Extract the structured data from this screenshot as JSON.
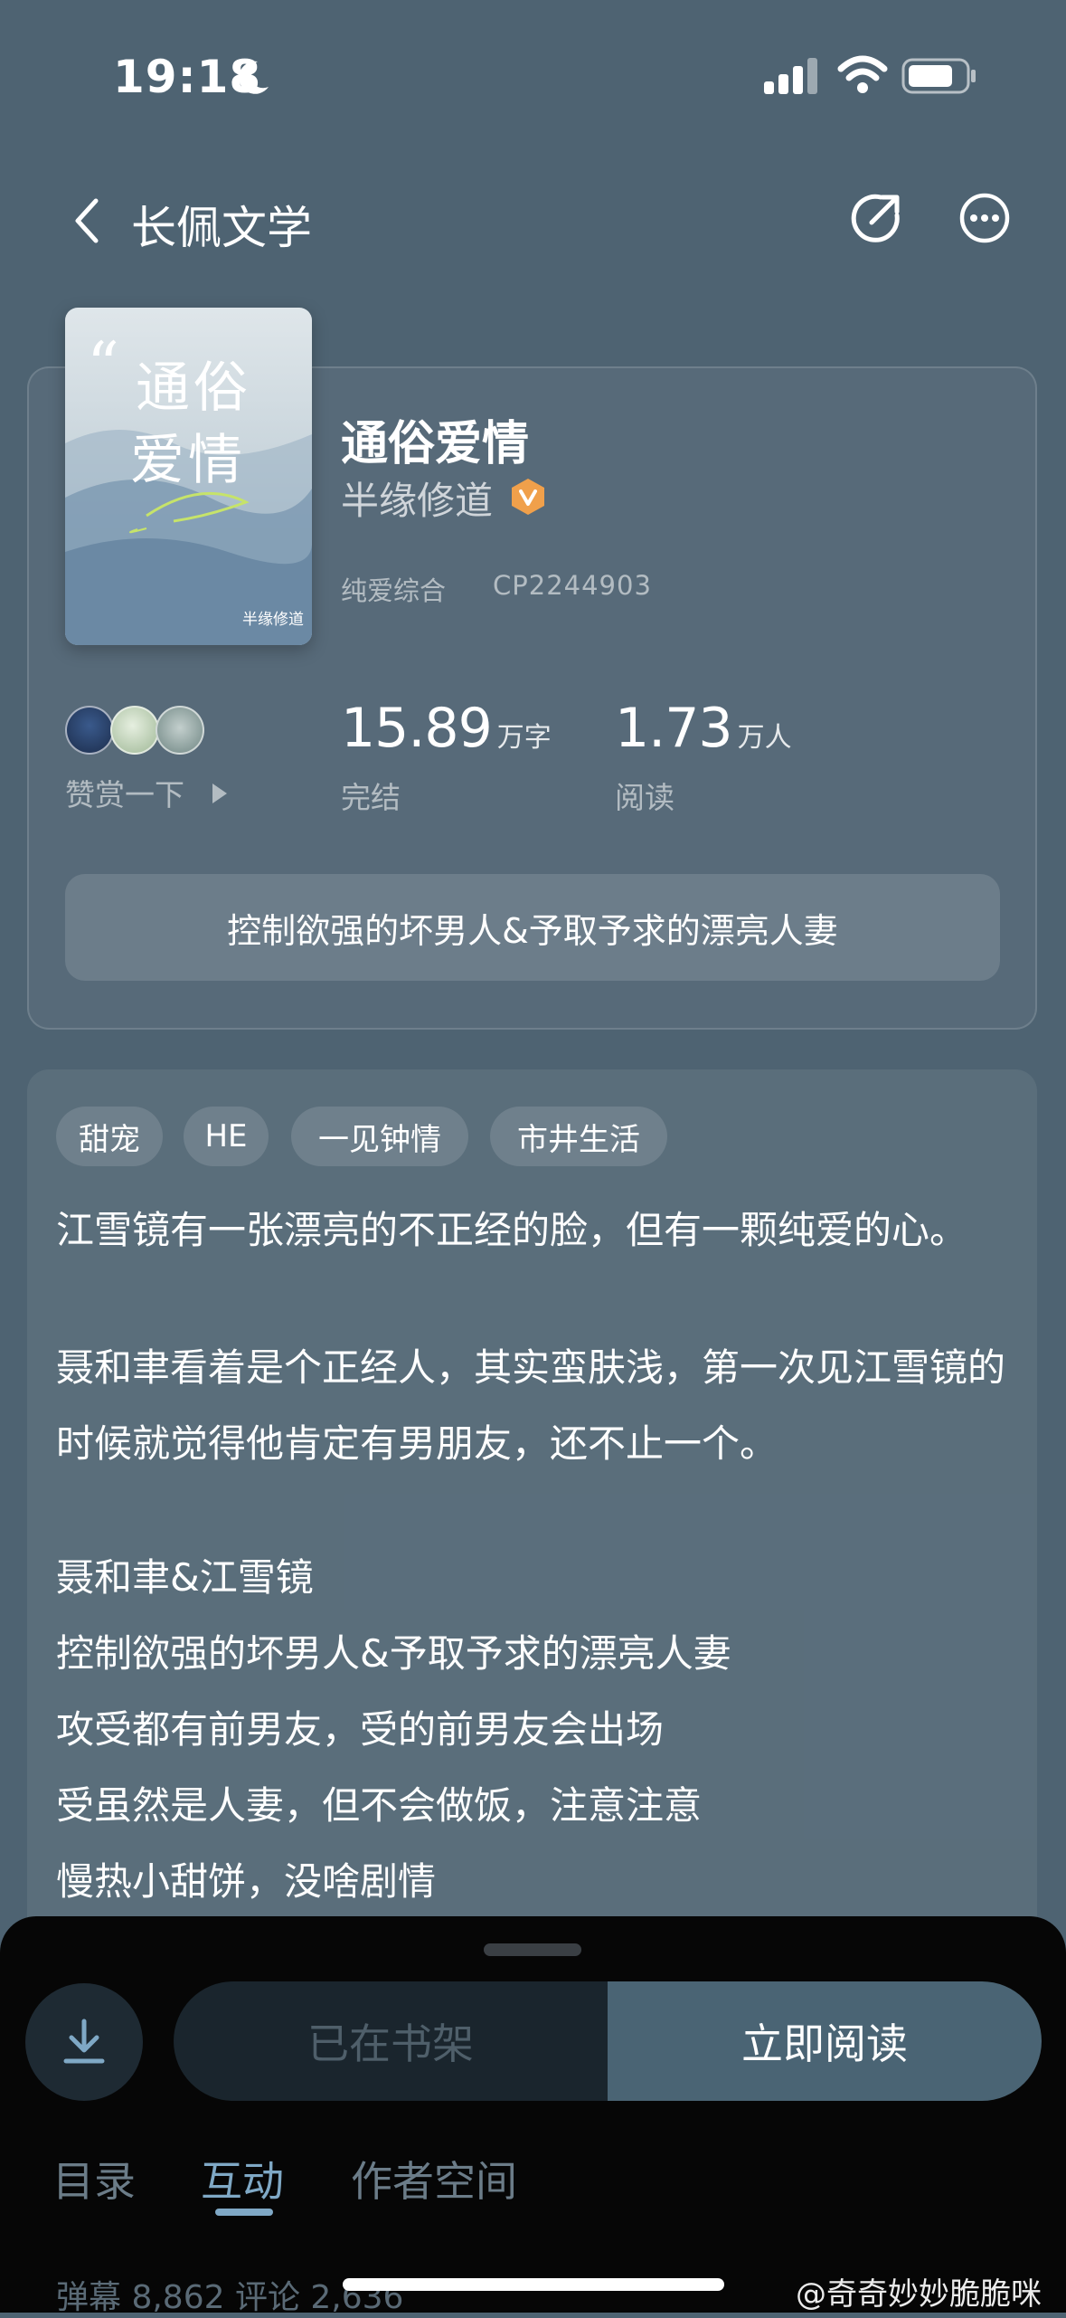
{
  "status_bar": {
    "time": "19:18"
  },
  "nav": {
    "title": "长佩文学"
  },
  "book": {
    "title": "通俗爱情",
    "author": "半缘修道",
    "category": "纯爱综合",
    "cp_id": "CP2244903",
    "cover": {
      "title_line1": "通俗",
      "title_line2": "爱情",
      "author": "半缘修道"
    },
    "reward_label": "赞赏一下",
    "words": {
      "value": "15.89",
      "unit": "万字",
      "label": "完结"
    },
    "reads": {
      "value": "1.73",
      "unit": "万人",
      "label": "阅读"
    },
    "tagline": "控制欲强的坏男人&予取予求的漂亮人妻"
  },
  "tags": [
    "甜宠",
    "HE",
    "一见钟情",
    "市井生活"
  ],
  "description": [
    "江雪镜有一张漂亮的不正经的脸，但有一颗纯爱的心。",
    "聂和聿看着是个正经人，其实蛮肤浅，第一次见江雪镜的时候就觉得他肯定有男朋友，还不止一个。",
    "聂和聿&江雪镜",
    "控制欲强的坏男人&予取予求的漂亮人妻",
    "攻受都有前男友，受的前男友会出场",
    "受虽然是人妻，但不会做饭，注意注意",
    "慢热小甜饼，没啥剧情"
  ],
  "actions": {
    "shelf": "已在书架",
    "read": "立即阅读"
  },
  "tabs": [
    "目录",
    "互动",
    "作者空间"
  ],
  "bottom_stats": "弹幕 8,862  评论 2,636",
  "watermark": "@奇奇妙妙脆脆咪",
  "colors": {
    "background": "#4e6372",
    "accent": "#7fa8c5",
    "vip_badge": "#f0a04b"
  }
}
